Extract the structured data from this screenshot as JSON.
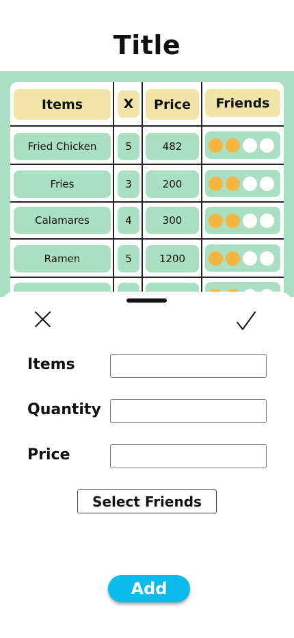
{
  "page": {
    "title": "Title"
  },
  "table": {
    "headers": {
      "items": "Items",
      "qty": "X",
      "price": "Price",
      "friends": "Friends"
    },
    "rows": [
      {
        "item": "Fried Chicken",
        "qty": "5",
        "price": "482",
        "friends": [
          true,
          true,
          false,
          false
        ]
      },
      {
        "item": "Fries",
        "qty": "3",
        "price": "200",
        "friends": [
          true,
          true,
          false,
          false
        ]
      },
      {
        "item": "Calamares",
        "qty": "4",
        "price": "300",
        "friends": [
          true,
          true,
          false,
          false
        ]
      },
      {
        "item": "Ramen",
        "qty": "5",
        "price": "1200",
        "friends": [
          true,
          true,
          false,
          false
        ]
      },
      {
        "item": "",
        "qty": "",
        "price": "",
        "friends": [
          true,
          true,
          false,
          false
        ]
      }
    ]
  },
  "sheet": {
    "close_icon": "close-icon",
    "confirm_icon": "checkmark-icon",
    "items_label": "Items",
    "quantity_label": "Quantity",
    "price_label": "Price",
    "items_value": "",
    "quantity_value": "",
    "price_value": "",
    "select_friends_label": "Select Friends",
    "add_label": "Add"
  },
  "colors": {
    "table_background": "#abdfc3",
    "header_cell": "#f2e5a9",
    "friend_selected": "#f4b63f",
    "friend_unselected": "#ffffff",
    "add_button": "#0bbbea"
  }
}
